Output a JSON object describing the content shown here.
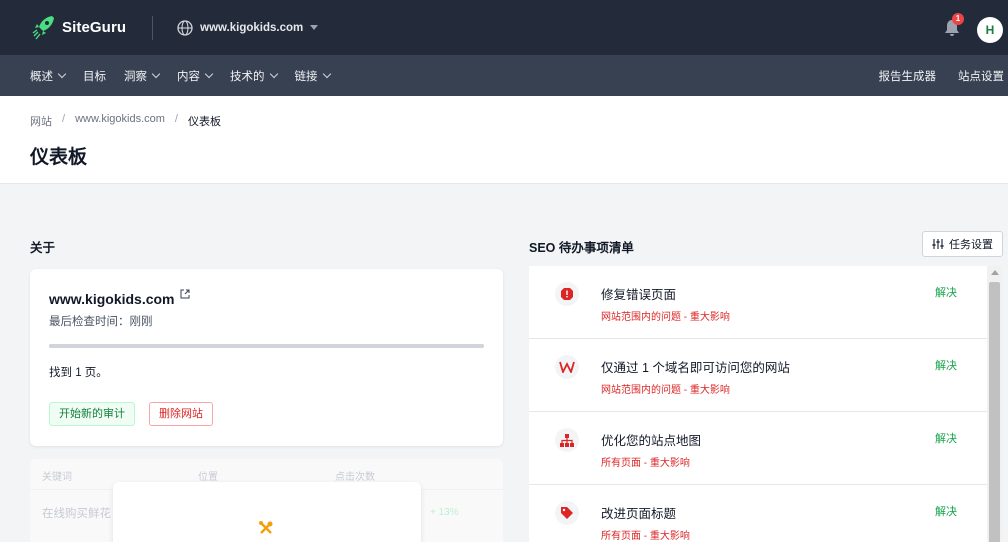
{
  "header": {
    "logo_text": "SiteGuru",
    "site_selector": "www.kigokids.com",
    "notification_count": "1",
    "avatar_initial": "H"
  },
  "nav": {
    "items": [
      {
        "label": "概述",
        "has_dropdown": true
      },
      {
        "label": "目标",
        "has_dropdown": false
      },
      {
        "label": "洞察",
        "has_dropdown": true
      },
      {
        "label": "内容",
        "has_dropdown": true
      },
      {
        "label": "技术的",
        "has_dropdown": true
      },
      {
        "label": "链接",
        "has_dropdown": true
      }
    ],
    "right": [
      "报告生成器",
      "站点设置"
    ]
  },
  "breadcrumb": [
    "网站",
    "www.kigokids.com",
    "仪表板"
  ],
  "page_title": "仪表板",
  "about": {
    "heading": "关于",
    "domain": "www.kigokids.com",
    "last_checked": "最后检查时间：刚刚",
    "progress_fraction": 1.0,
    "found_pages": "找到 1 页。",
    "start_audit_label": "开始新的审计",
    "delete_site_label": "删除网站"
  },
  "keywords": {
    "columns": [
      "关键词",
      "位置",
      "点击次数"
    ],
    "row": [
      "在线购买鲜花",
      "+ 13%"
    ]
  },
  "seo": {
    "heading": "SEO 待办事项清单",
    "task_settings_label": "任务设置",
    "items": [
      {
        "icon": "error-icon",
        "title": "修复错误页面",
        "subtitle": "网站范围内的问题 - 重大影响",
        "action": "解决"
      },
      {
        "icon": "w-domain-icon",
        "title": "仅通过 1 个域名即可访问您的网站",
        "subtitle": "网站范围内的问题 - 重大影响",
        "action": "解决"
      },
      {
        "icon": "sitemap-icon",
        "title": "优化您的站点地图",
        "subtitle": "所有页面 - 重大影响",
        "action": "解决"
      },
      {
        "icon": "tag-icon",
        "title": "改进页面标题",
        "subtitle": "所有页面 - 重大影响",
        "action": "解决"
      }
    ]
  },
  "colors": {
    "header_bg": "#232b3a",
    "nav_bg": "#374151",
    "success": "#16a34a",
    "danger": "#dc2626"
  }
}
